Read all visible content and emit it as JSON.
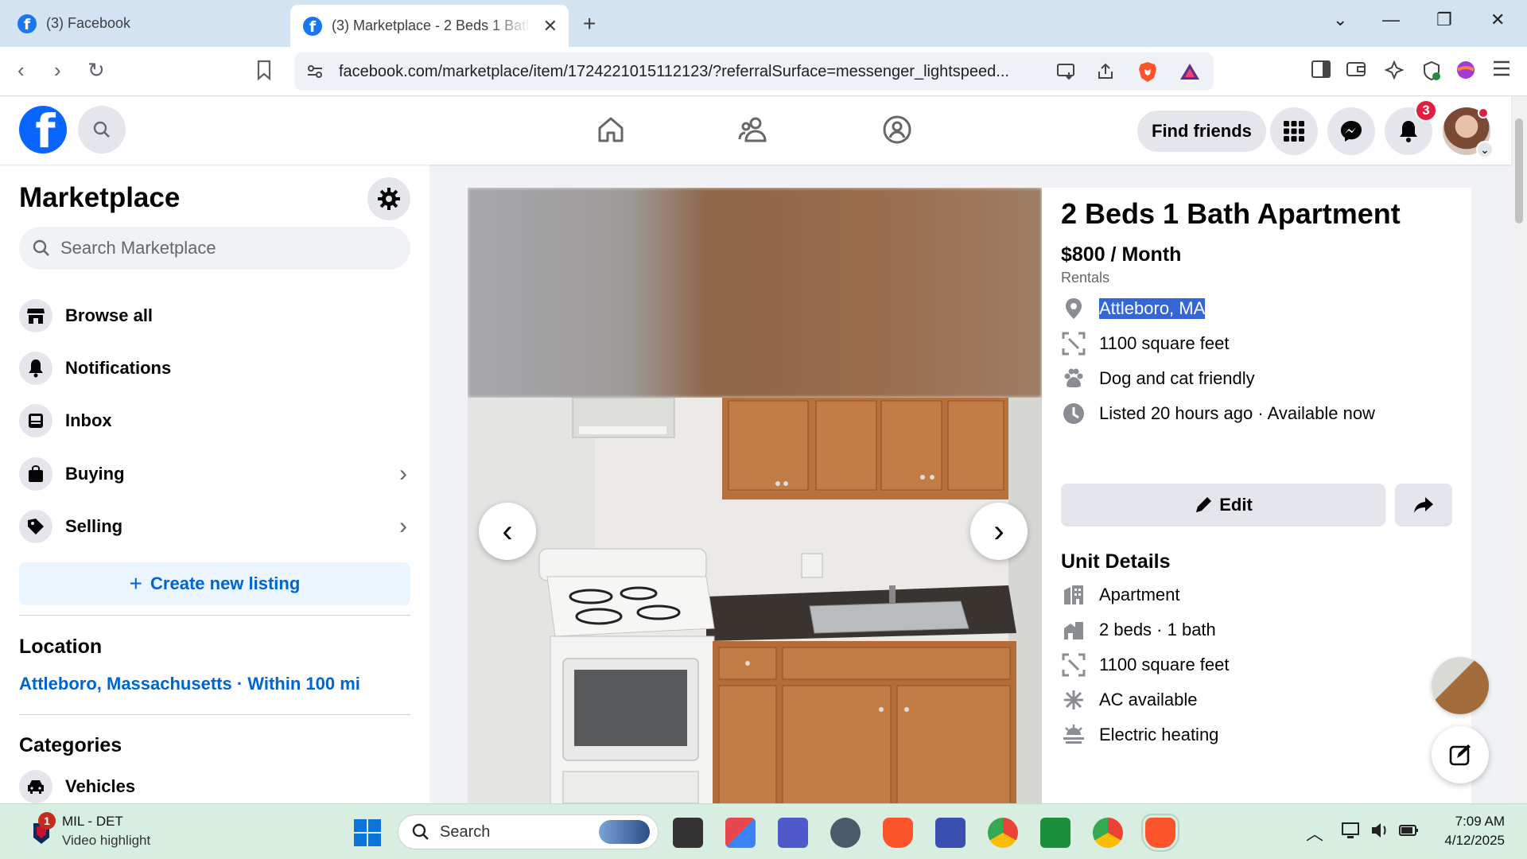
{
  "browser": {
    "tabs": [
      {
        "title": "(3) Facebook",
        "active": false
      },
      {
        "title": "(3) Marketplace - 2 Beds 1 Bath Apartment",
        "active": true
      }
    ],
    "new_tab": "+",
    "url": "facebook.com/marketplace/item/1724221015112123/?referralSurface=messenger_lightspeed..."
  },
  "fb_header": {
    "find_friends_label": "Find friends",
    "notification_count": "3"
  },
  "sidebar": {
    "title": "Marketplace",
    "search_placeholder": "Search Marketplace",
    "items": [
      {
        "label": "Browse all",
        "icon": "storefront-icon"
      },
      {
        "label": "Notifications",
        "icon": "bell-icon"
      },
      {
        "label": "Inbox",
        "icon": "inbox-icon"
      },
      {
        "label": "Buying",
        "icon": "bag-icon"
      },
      {
        "label": "Selling",
        "icon": "tag-icon"
      }
    ],
    "create_listing_label": "Create new listing",
    "location_title": "Location",
    "location_value": "Attleboro, Massachusetts · Within 100 mi",
    "categories_title": "Categories",
    "categories": [
      {
        "label": "Vehicles",
        "icon": "car-icon"
      }
    ]
  },
  "listing": {
    "title": "2 Beds 1 Bath Apartment",
    "price": "$800 / Month",
    "category": "Rentals",
    "location": "Attleboro, MA",
    "facts": [
      {
        "icon": "area-icon",
        "text": "1100 square feet"
      },
      {
        "icon": "paw-icon",
        "text": "Dog and cat friendly"
      },
      {
        "icon": "clock-icon",
        "text": "Listed 20 hours ago · Available now"
      }
    ],
    "edit_label": "Edit",
    "unit_details_title": "Unit Details",
    "unit_details": [
      {
        "icon": "building-icon",
        "text": "Apartment"
      },
      {
        "icon": "bed-icon",
        "text": "2 beds · 1 bath"
      },
      {
        "icon": "area-icon",
        "text": "1100 square feet"
      },
      {
        "icon": "snowflake-icon",
        "text": "AC available"
      },
      {
        "icon": "heat-icon",
        "text": "Electric heating"
      }
    ]
  },
  "taskbar": {
    "news_title": "MIL - DET",
    "news_subtitle": "Video highlight",
    "news_badge": "1",
    "search_placeholder": "Search",
    "time": "7:09 AM",
    "date": "4/12/2025"
  },
  "colors": {
    "fb_blue": "#0866ff",
    "link_blue": "#0064d1",
    "badge_red": "#e41e3f",
    "page_bg": "#f0f2f5"
  }
}
